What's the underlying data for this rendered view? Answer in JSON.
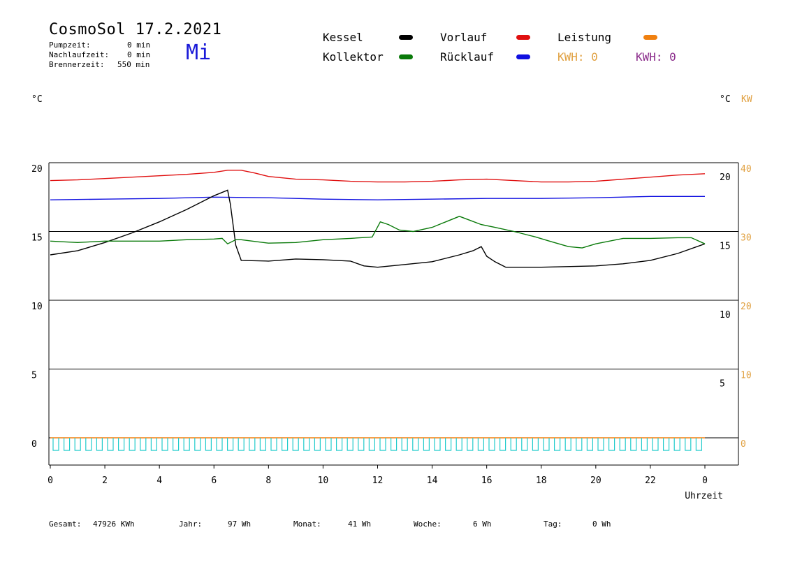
{
  "header": {
    "title": "CosmoSol 17.2.2021",
    "day": "Mi",
    "info": [
      {
        "label": "Pumpzeit:",
        "value": "0 min"
      },
      {
        "label": "Nachlaufzeit:",
        "value": "0 min"
      },
      {
        "label": "Brennerzeit:",
        "value": "550 min"
      }
    ]
  },
  "legend": {
    "kessel": "Kessel",
    "kollektor": "Kollektor",
    "vorlauf": "Vorlauf",
    "ruecklauf": "Rücklauf",
    "leistung": "Leistung",
    "kwh1": "KWH: 0",
    "kwh2": "KWH: 0"
  },
  "colors": {
    "kessel": "#000000",
    "kollektor": "#0a7a0a",
    "vorlauf": "#e01010",
    "ruecklauf": "#1010e0",
    "leistung": "#f08010",
    "kwh2": "#8a2a8a",
    "pump": "#22cccc",
    "axis_orange": "#e0a040"
  },
  "footer": {
    "gesamt_label": "Gesamt:",
    "gesamt_value": "47926 KWh",
    "jahr_label": "Jahr:",
    "jahr_value": "97 Wh",
    "monat_label": "Monat:",
    "monat_value": "41 Wh",
    "woche_label": "Woche:",
    "woche_value": "6 Wh",
    "tag_label": "Tag:",
    "tag_value": "0 Wh"
  },
  "chart_data": {
    "type": "line",
    "xlabel": "Uhrzeit",
    "ylabel_left": "°C",
    "ylabel_right": "°C",
    "ylabel_right2": "KW",
    "xlim": [
      0,
      24
    ],
    "ylim": [
      -1.5,
      20.2
    ],
    "x_ticks": [
      "0",
      "2",
      "4",
      "6",
      "8",
      "10",
      "12",
      "14",
      "16",
      "18",
      "20",
      "22",
      "0"
    ],
    "y_left_ticks": [
      "0",
      "5",
      "10",
      "15",
      "20"
    ],
    "y_right_ticks": [
      "5",
      "10",
      "15",
      "20"
    ],
    "y_right2_ticks": [
      "0",
      "10",
      "20",
      "30",
      "40"
    ],
    "grid": "horizontal",
    "series": [
      {
        "name": "Vorlauf",
        "color": "#e01010",
        "x": [
          0,
          1,
          2,
          3,
          4,
          5,
          6,
          6.5,
          7,
          7.5,
          8,
          9,
          10,
          11,
          12,
          13,
          14,
          15,
          16,
          17,
          18,
          19,
          20,
          21,
          22,
          23,
          24
        ],
        "y": [
          18.7,
          18.75,
          18.85,
          18.95,
          19.05,
          19.15,
          19.3,
          19.45,
          19.45,
          19.25,
          19.0,
          18.8,
          18.75,
          18.65,
          18.6,
          18.6,
          18.65,
          18.75,
          18.8,
          18.7,
          18.6,
          18.6,
          18.65,
          18.8,
          18.95,
          19.1,
          19.2
        ]
      },
      {
        "name": "Rücklauf",
        "color": "#1010e0",
        "x": [
          0,
          2,
          4,
          6,
          8,
          10,
          12,
          14,
          16,
          18,
          20,
          22,
          24
        ],
        "y": [
          17.3,
          17.35,
          17.4,
          17.5,
          17.45,
          17.35,
          17.3,
          17.35,
          17.4,
          17.4,
          17.45,
          17.55,
          17.55
        ]
      },
      {
        "name": "Kessel",
        "color": "#000000",
        "x": [
          0,
          1,
          2,
          3,
          4,
          5,
          6,
          6.5,
          6.6,
          6.8,
          7,
          8,
          9,
          10,
          11,
          11.5,
          12,
          13,
          14,
          15,
          15.5,
          15.8,
          16,
          16.3,
          16.7,
          18,
          20,
          21,
          22,
          23,
          24
        ],
        "y": [
          13.3,
          13.6,
          14.2,
          14.9,
          15.7,
          16.6,
          17.6,
          18.0,
          17.0,
          14.0,
          12.9,
          12.85,
          13.0,
          12.95,
          12.85,
          12.5,
          12.4,
          12.6,
          12.8,
          13.3,
          13.6,
          13.9,
          13.2,
          12.8,
          12.4,
          12.4,
          12.5,
          12.65,
          12.9,
          13.4,
          14.1
        ]
      },
      {
        "name": "Kollektor",
        "color": "#0a7a0a",
        "x": [
          0,
          1,
          2,
          3,
          4,
          5,
          6,
          6.3,
          6.5,
          6.8,
          7,
          8,
          9,
          10,
          11,
          11.8,
          12.1,
          12.4,
          12.8,
          13.3,
          14,
          14.5,
          15,
          15.4,
          15.8,
          16.3,
          17,
          17.8,
          18.3,
          19,
          19.5,
          20,
          21,
          22,
          23,
          23.5,
          24
        ],
        "y": [
          14.3,
          14.2,
          14.3,
          14.3,
          14.3,
          14.4,
          14.45,
          14.5,
          14.1,
          14.4,
          14.4,
          14.15,
          14.2,
          14.4,
          14.5,
          14.6,
          15.7,
          15.5,
          15.1,
          15.0,
          15.3,
          15.7,
          16.1,
          15.8,
          15.5,
          15.3,
          15.0,
          14.6,
          14.3,
          13.9,
          13.8,
          14.1,
          14.5,
          14.5,
          14.55,
          14.55,
          14.1
        ]
      },
      {
        "name": "Leistung",
        "color": "#f08010",
        "x": [
          0,
          24
        ],
        "y": [
          0,
          0
        ]
      }
    ]
  }
}
